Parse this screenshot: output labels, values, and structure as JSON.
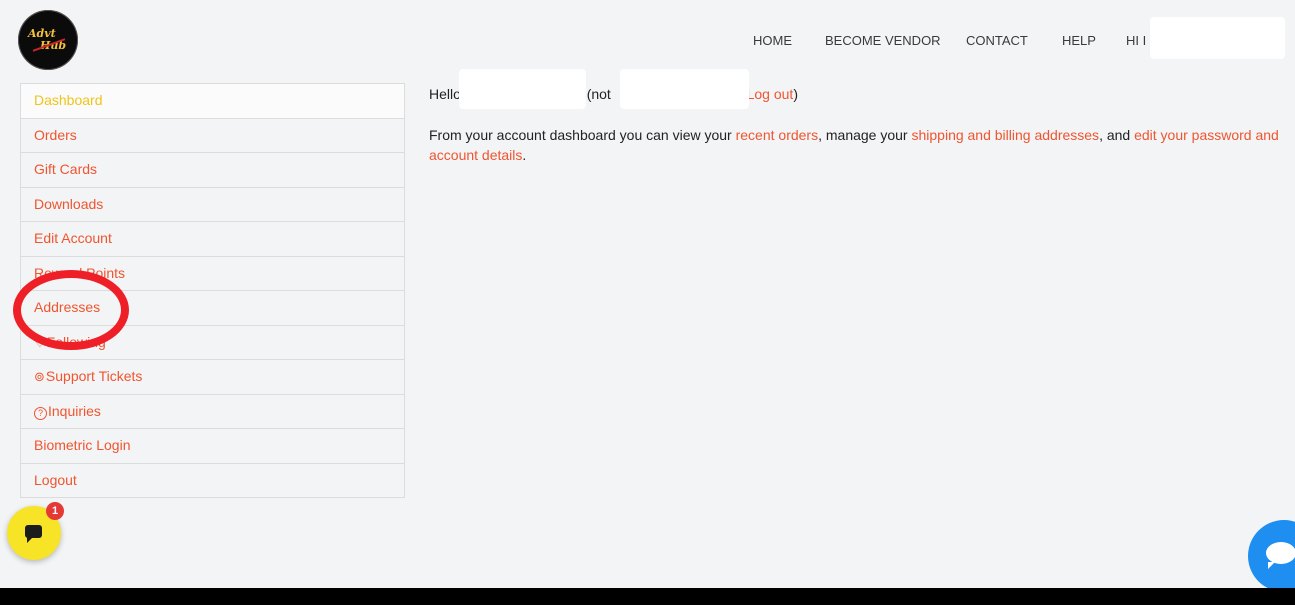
{
  "logo": {
    "line1": "Advt",
    "line2": "Hub"
  },
  "nav": {
    "items": [
      "HOME",
      "BECOME VENDOR",
      "CONTACT",
      "HELP"
    ],
    "greeting": "HI I"
  },
  "sidebar": {
    "items": [
      {
        "label": "Dashboard",
        "icon": ""
      },
      {
        "label": "Orders",
        "icon": ""
      },
      {
        "label": "Gift Cards",
        "icon": ""
      },
      {
        "label": "Downloads",
        "icon": ""
      },
      {
        "label": "Edit Account",
        "icon": ""
      },
      {
        "label": "Reward Points",
        "icon": ""
      },
      {
        "label": "Addresses",
        "icon": ""
      },
      {
        "label": "Following",
        "icon": "♡"
      },
      {
        "label": "Support Tickets",
        "icon": "⊚"
      },
      {
        "label": "Inquiries",
        "icon": "?"
      },
      {
        "label": "Biometric Login",
        "icon": ""
      },
      {
        "label": "Logout",
        "icon": ""
      }
    ]
  },
  "content": {
    "hello": "Hello",
    "not": "(not",
    "logout_link": "Log out",
    "close_paren": ")",
    "desc_1": "From your account dashboard you can view your",
    "link_orders": "recent orders",
    "desc_2": ", manage your",
    "link_addresses": "shipping and billing addresses",
    "desc_3": ", and",
    "link_account": "edit your password and account details",
    "desc_4": "."
  },
  "chat": {
    "badge": "1"
  },
  "colors": {
    "accent": "#f0552f",
    "active": "#f0c419",
    "annotation": "#ef1f28"
  }
}
